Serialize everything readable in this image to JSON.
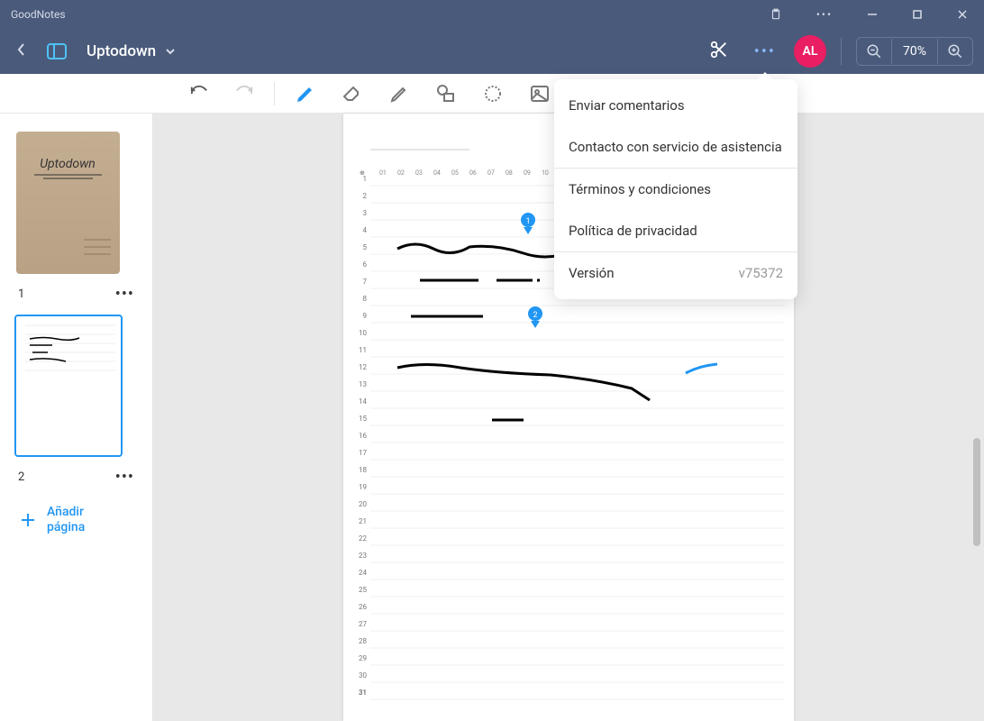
{
  "app_name": "GoodNotes",
  "document": {
    "title": "Uptodown"
  },
  "avatar": {
    "initials": "AL"
  },
  "zoom": {
    "value": "70%"
  },
  "sidebar": {
    "pages": [
      {
        "number": "1"
      },
      {
        "number": "2"
      }
    ],
    "add_page": "Añadir\npágina"
  },
  "dropdown": {
    "items": [
      {
        "label": "Enviar comentarios"
      },
      {
        "label": "Contacto con servicio de asistencia"
      },
      {
        "label": "Términos y condiciones"
      },
      {
        "label": "Política de privacidad"
      }
    ],
    "version_label": "Versión",
    "version_value": "v75372"
  },
  "canvas": {
    "columns": [
      "01",
      "02",
      "03",
      "04",
      "05",
      "06",
      "07",
      "08",
      "09",
      "10"
    ],
    "rows": [
      "1",
      "2",
      "3",
      "4",
      "5",
      "6",
      "7",
      "8",
      "9",
      "10",
      "11",
      "12",
      "13",
      "14",
      "15",
      "16",
      "17",
      "18",
      "19",
      "20",
      "21",
      "22",
      "23",
      "24",
      "25",
      "26",
      "27",
      "28",
      "29",
      "30",
      "31"
    ],
    "pins": [
      "1",
      "2"
    ]
  }
}
